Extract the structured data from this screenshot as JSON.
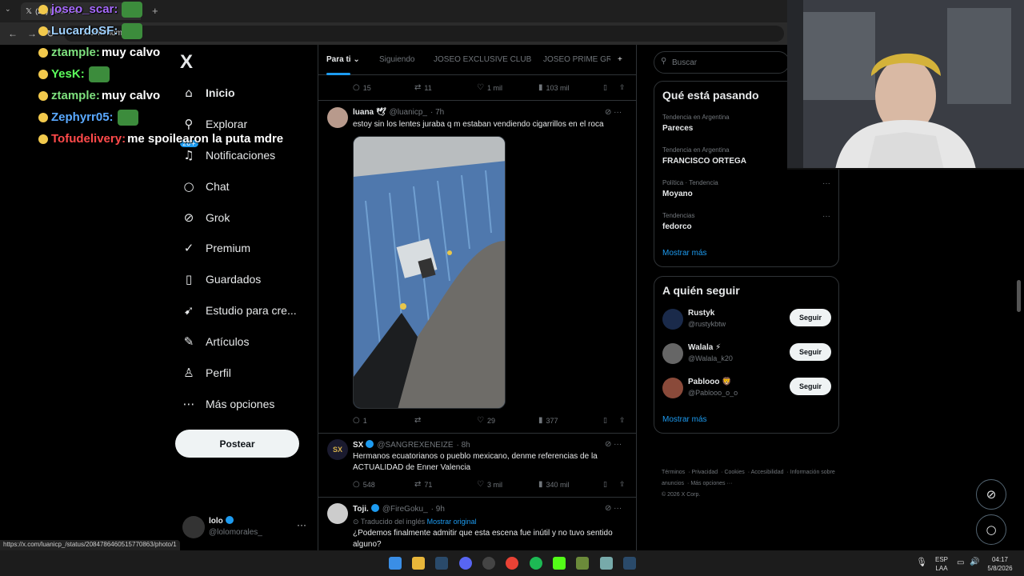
{
  "browser": {
    "tab_title": "(21) Inicio / X",
    "url": "x.com/home",
    "status_url": "https://x.com/luanicp_/status/2084786460515770863/photo/1"
  },
  "chat": [
    {
      "user": "joseo_scar:",
      "message": "",
      "color": "#a86bff"
    },
    {
      "user": "LucardoSF:",
      "message": "",
      "color": "#9fd1ff"
    },
    {
      "user": "ztample:",
      "message": "muy calvo",
      "color": "#7ee07e"
    },
    {
      "user": "YesK:",
      "message": "",
      "color": "#5cff5c"
    },
    {
      "user": "ztample:",
      "message": "muy calvo",
      "color": "#7ee07e"
    },
    {
      "user": "Zephyrr05:",
      "message": "",
      "color": "#5aa9ff"
    },
    {
      "user": "Tofudelivery:",
      "message": "me spoilearon la puta mdre",
      "color": "#ff4a4a"
    }
  ],
  "sidebar": {
    "logo": "X",
    "items": [
      {
        "label": "Inicio",
        "icon": "home-icon",
        "glyph": "⌂"
      },
      {
        "label": "Explorar",
        "icon": "search-icon",
        "glyph": "⚲"
      },
      {
        "label": "Notificaciones",
        "icon": "bell-icon",
        "glyph": "♫",
        "badge": "20+"
      },
      {
        "label": "Chat",
        "icon": "chat-icon",
        "glyph": "○"
      },
      {
        "label": "Grok",
        "icon": "grok-icon",
        "glyph": "⊘"
      },
      {
        "label": "Premium",
        "icon": "premium-icon",
        "glyph": "✓"
      },
      {
        "label": "Guardados",
        "icon": "bookmark-icon",
        "glyph": "▯"
      },
      {
        "label": "Estudio para cre...",
        "icon": "rocket-icon",
        "glyph": "➹"
      },
      {
        "label": "Artículos",
        "icon": "article-icon",
        "glyph": "✎"
      },
      {
        "label": "Perfil",
        "icon": "person-icon",
        "glyph": "♙"
      },
      {
        "label": "Más opciones",
        "icon": "more-icon",
        "glyph": "⋯"
      }
    ],
    "post_label": "Postear",
    "account": {
      "name": "lolo",
      "handle": "@lolomorales_",
      "more": "···"
    }
  },
  "feed": {
    "tabs": [
      "Para ti",
      "Siguiendo",
      "JOSEO EXCLUSIVE CLUB",
      "JOSEO PRIME GR"
    ],
    "add_tab": "+",
    "tweets": [
      {
        "name": "",
        "handle": "",
        "time": "",
        "text": "",
        "replies": "15",
        "reposts": "11",
        "likes": "1 mil",
        "views": "103 mil"
      },
      {
        "name": "luana 🕊",
        "handle": "@luanicp_",
        "time": "· 7h",
        "text": "estoy sin los lentes juraba q m estaban vendiendo cigarrillos en el roca",
        "replies": "1",
        "reposts": "",
        "likes": "29",
        "views": "377"
      },
      {
        "name": "SX",
        "handle": "@SANGREXENEIZE",
        "time": "· 8h",
        "text": "Hermanos ecuatorianos o pueblo mexicano, denme referencias de la ACTUALIDAD de Enner Valencia",
        "replies": "548",
        "reposts": "71",
        "likes": "3 mil",
        "views": "340 mil"
      },
      {
        "name": "Toji.",
        "handle": "@FireGoku_",
        "time": "· 9h",
        "translated": "Traducido del inglés",
        "show_original": "Mostrar original",
        "text": "¿Podemos finalmente admitir que esta escena fue inútil y no tuvo sentido alguno?"
      }
    ]
  },
  "right": {
    "search_placeholder": "Buscar",
    "trends_title": "Qué está pasando",
    "trends": [
      {
        "context": "Tendencia en Argentina",
        "name": "Pareces"
      },
      {
        "context": "Tendencia en Argentina",
        "name": "FRANCISCO ORTEGA"
      },
      {
        "context": "Política · Tendencia",
        "name": "Moyano"
      },
      {
        "context": "Tendencias",
        "name": "fedorco"
      }
    ],
    "show_more": "Mostrar más",
    "wtf_title": "A quién seguir",
    "who_to_follow": [
      {
        "name": "Rustyk",
        "handle": "@rustykbtw"
      },
      {
        "name": "Walala ⚡",
        "handle": "@Walala_k20"
      },
      {
        "name": "Pablooo 🦁",
        "handle": "@Pablooo_o_o"
      }
    ],
    "follow_label": "Seguir",
    "footer": [
      "Términos",
      "Privacidad",
      "Cookies",
      "Accesibilidad",
      "Información sobre anuncios",
      "Más opciones ···",
      "© 2026 X Corp."
    ]
  },
  "taskbar": {
    "lang": "ESP",
    "lang2": "LAA",
    "time": "04:17",
    "date": "5/8/2026"
  },
  "colors": {
    "accent": "#1d9bf0",
    "background": "#000000",
    "border": "#2f3336",
    "muted": "#71767b"
  }
}
